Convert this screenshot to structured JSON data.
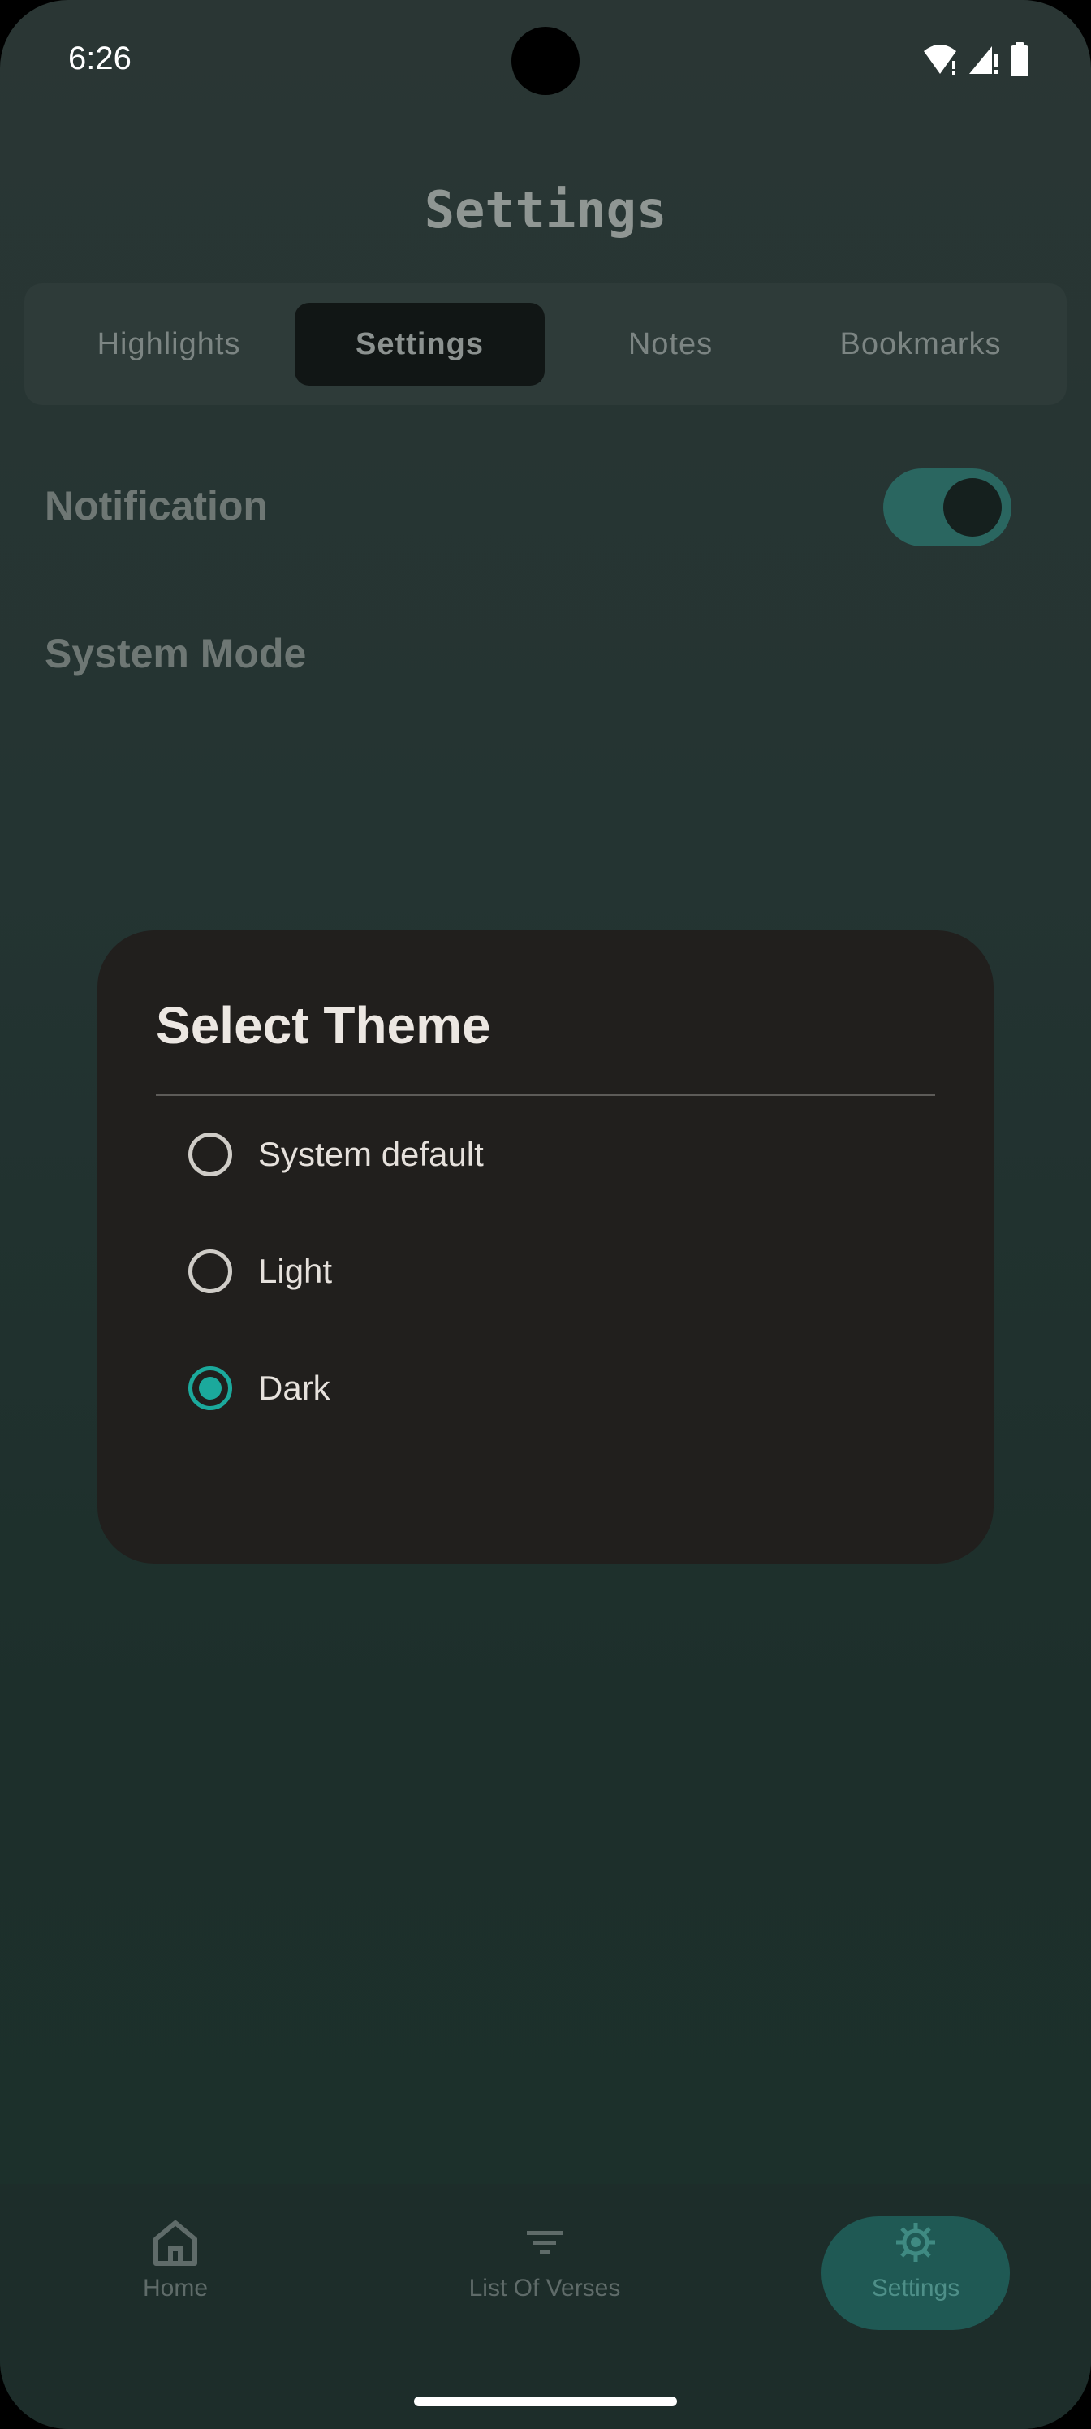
{
  "status_bar": {
    "time": "6:26"
  },
  "header": {
    "title": "Settings"
  },
  "tabs": [
    {
      "label": "Highlights",
      "active": false
    },
    {
      "label": "Settings",
      "active": true
    },
    {
      "label": "Notes",
      "active": false
    },
    {
      "label": "Bookmarks",
      "active": false
    }
  ],
  "settings": {
    "notification_label": "Notification",
    "notification_enabled": true,
    "system_mode_label": "System Mode"
  },
  "dialog": {
    "title": "Select Theme",
    "options": [
      {
        "label": "System default",
        "selected": false
      },
      {
        "label": "Light",
        "selected": false
      },
      {
        "label": "Dark",
        "selected": true
      }
    ],
    "accent_color": "#1ba99c"
  },
  "bottom_nav": {
    "items": [
      {
        "label": "Home",
        "icon": "home-icon",
        "active": false
      },
      {
        "label": "List Of Verses",
        "icon": "filter-icon",
        "active": false
      },
      {
        "label": "Settings",
        "icon": "gear-icon",
        "active": true
      }
    ]
  }
}
